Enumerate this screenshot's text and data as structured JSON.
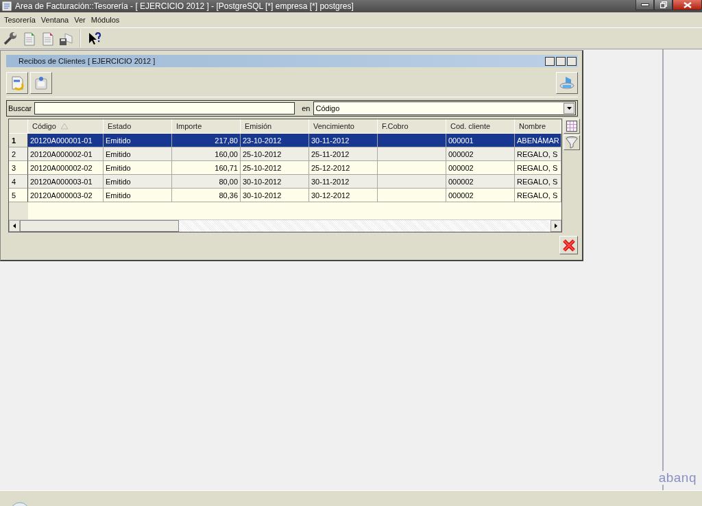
{
  "window": {
    "title": "Area de Facturación::Tesorería  - [ EJERCICIO 2012 ] - [PostgreSQL [*] empresa [*] postgres]"
  },
  "menu": [
    "Tesorería",
    "Ventana",
    "Ver",
    "Módulos"
  ],
  "subwindow": {
    "title": "Recibos de Clientes [ EJERCICIO 2012 ]",
    "search": {
      "label": "Buscar",
      "in_label": "en",
      "field": "Código"
    },
    "table": {
      "columns": [
        {
          "label": "Código",
          "kind": "text",
          "sorted": true
        },
        {
          "label": "Estado",
          "kind": "text",
          "sorted": false
        },
        {
          "label": "Importe",
          "kind": "amount",
          "sorted": false
        },
        {
          "label": "Emisión",
          "kind": "text",
          "sorted": false
        },
        {
          "label": "Vencimiento",
          "kind": "text",
          "sorted": false
        },
        {
          "label": "F.Cobro",
          "kind": "text",
          "sorted": false
        },
        {
          "label": "Cod. cliente",
          "kind": "text",
          "sorted": false
        },
        {
          "label": "Nombre",
          "kind": "text",
          "sorted": false
        }
      ],
      "rows": [
        {
          "number": "1",
          "selected": true,
          "cells": [
            "20120A000001-01",
            "Emitido",
            "217,80",
            "23-10-2012",
            "30-11-2012",
            "",
            "000001",
            "ABENÁMAR"
          ]
        },
        {
          "number": "2",
          "selected": false,
          "cells": [
            "20120A000002-01",
            "Emitido",
            "160,00",
            "25-10-2012",
            "25-11-2012",
            "",
            "000002",
            "REGALO, S"
          ]
        },
        {
          "number": "3",
          "selected": false,
          "cells": [
            "20120A000002-02",
            "Emitido",
            "160,71",
            "25-10-2012",
            "25-12-2012",
            "",
            "000002",
            "REGALO, S"
          ]
        },
        {
          "number": "4",
          "selected": false,
          "cells": [
            "20120A000003-01",
            "Emitido",
            "80,00",
            "30-10-2012",
            "30-11-2012",
            "",
            "000002",
            "REGALO, S"
          ]
        },
        {
          "number": "5",
          "selected": false,
          "cells": [
            "20120A000003-02",
            "Emitido",
            "80,36",
            "30-10-2012",
            "30-12-2012",
            "",
            "000002",
            "REGALO, S"
          ]
        }
      ]
    }
  },
  "logo": "abanq"
}
